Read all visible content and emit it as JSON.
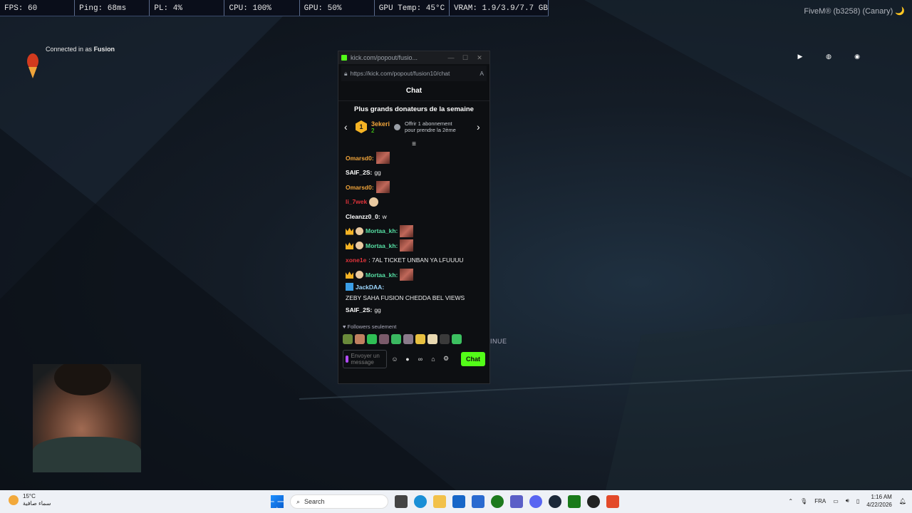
{
  "stats": [
    "FPS: 60",
    "Ping: 68ms",
    "PL: 4%",
    "CPU: 100%",
    "GPU: 50%",
    "GPU Temp: 45°C",
    "VRAM: 1.9/3.9/7.7 GB"
  ],
  "fivem_label": "FiveM® (b3258) (Canary) 🌙",
  "connected": {
    "prefix": "Connected in as",
    "user": "Fusion"
  },
  "continue_text": "INUE",
  "popup": {
    "tab_title": "kick.com/popout/fusio...",
    "url": "https://kick.com/popout/fusion10/chat",
    "chat_title": "Chat",
    "donors_title": "Plus grands donateurs de la semaine",
    "donor": {
      "rank": "1",
      "name": "3ekeri",
      "count": "2",
      "offer_line1": "Offrir 1 abonnement",
      "offer_line2": "pour prendre la 2ème"
    },
    "messages": [
      {
        "user": "Omarsd0:",
        "color": "#f0a43a",
        "text": "",
        "badges": [],
        "emote": true
      },
      {
        "user": "SAIF_2S:",
        "color": "#ffffff",
        "text": "gg",
        "badges": [],
        "emote": false
      },
      {
        "user": "Omarsd0:",
        "color": "#f0a43a",
        "text": "",
        "badges": [],
        "emote": true
      },
      {
        "user": "li_7wek",
        "color": "#e0333a",
        "text": "",
        "badges": [],
        "emote": false,
        "round": true
      },
      {
        "user": "Cleanzz0_0:",
        "color": "#ffffff",
        "text": "w",
        "badges": [],
        "emote": false
      },
      {
        "user": "Mortaa_kh:",
        "color": "#56e0a4",
        "text": "",
        "badges": [
          "crown",
          "face"
        ],
        "emote": true
      },
      {
        "user": "Mortaa_kh:",
        "color": "#56e0a4",
        "text": "",
        "badges": [
          "crown",
          "face"
        ],
        "emote": true
      },
      {
        "user": "xone1e",
        "color": "#e0333a",
        "text": ": 7AL TICKET UNBAN YA LFUUUU",
        "badges": [],
        "emote": false
      },
      {
        "user": "Mortaa_kh:",
        "color": "#56e0a4",
        "text": "",
        "badges": [
          "crown",
          "face"
        ],
        "emote": true
      },
      {
        "user": "JackDAA:",
        "color": "#9ed8ff",
        "text": "ZEBY SAHA FUSION CHEDDA BEL VIEWS",
        "badges": [
          "jack"
        ],
        "emote": false
      },
      {
        "user": "SAIF_2S:",
        "color": "#ffffff",
        "text": "gg",
        "badges": [],
        "emote": false
      }
    ],
    "followers": "Followers seulement",
    "input_placeholder": "Envoyer un message",
    "chat_button": "Chat"
  },
  "taskbar": {
    "weather_temp": "15°C",
    "weather_desc": "سماء صافية",
    "search": "Search",
    "lang": "FRA",
    "time": "1:16 AM",
    "date": "4/22/2026"
  }
}
